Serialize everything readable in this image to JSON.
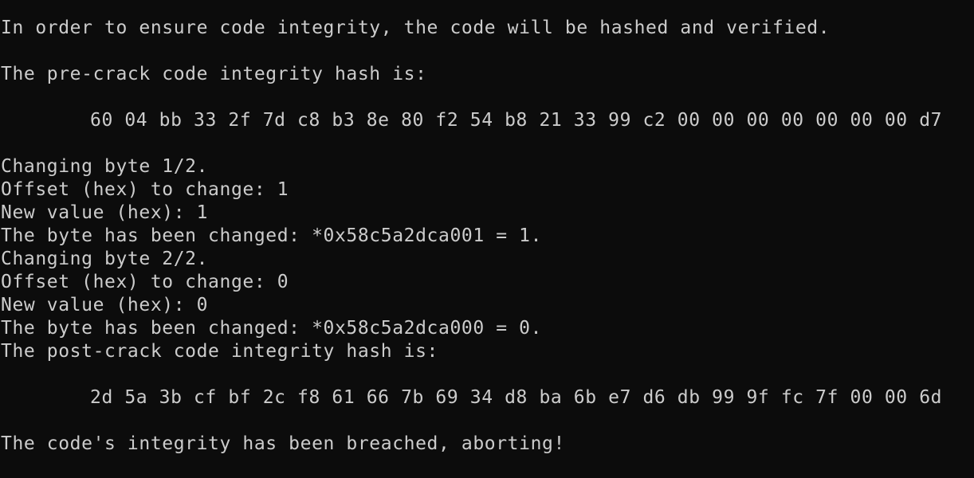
{
  "terminal": {
    "background": "#0c0c0c",
    "foreground": "#cccccc",
    "lines": [
      "In order to ensure code integrity, the code will be hashed and verified.",
      "",
      "The pre-crack code integrity hash is:",
      "",
      "60 04 bb 33 2f 7d c8 b3 8e 80 f2 54 b8 21 33 99 c2 00 00 00 00 00 00 00 d7",
      "",
      "Changing byte 1/2.",
      "Offset (hex) to change: 1",
      "New value (hex): 1",
      "The byte has been changed: *0x58c5a2dca001 = 1.",
      "Changing byte 2/2.",
      "Offset (hex) to change: 0",
      "New value (hex): 0",
      "The byte has been changed: *0x58c5a2dca000 = 0.",
      "The post-crack code integrity hash is:",
      "",
      "2d 5a 3b cf bf 2c f8 61 66 7b 69 34 d8 ba 6b e7 d6 db 99 9f fc 7f 00 00 6d",
      "",
      "The code's integrity has been breached, aborting!"
    ]
  }
}
